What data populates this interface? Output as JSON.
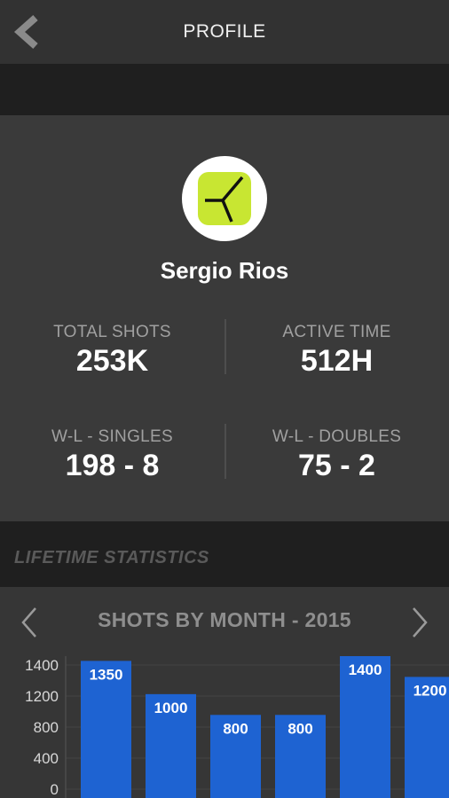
{
  "header": {
    "title": "PROFILE",
    "back_icon": "chevron-left-icon"
  },
  "profile": {
    "name": "Sergio Rios",
    "avatar_icon": "tennis-court-logo-icon",
    "accent_color": "#c8e632"
  },
  "stats": {
    "total_shots": {
      "label": "TOTAL SHOTS",
      "value": "253K"
    },
    "active_time": {
      "label": "ACTIVE TIME",
      "value": "512H"
    },
    "wl_singles": {
      "label": "W-L - SINGLES",
      "value": "198 - 8"
    },
    "wl_doubles": {
      "label": "W-L - DOUBLES",
      "value": "75 - 2"
    }
  },
  "section": {
    "heading": "LIFETIME STATISTICS"
  },
  "chart_data": {
    "type": "bar",
    "title": "SHOTS BY MONTH - 2015",
    "values": [
      1350,
      1000,
      800,
      800,
      1400,
      1200
    ],
    "value_labels": [
      "1350",
      "1000",
      "800",
      "800",
      "1400",
      "1200"
    ],
    "y_ticks": [
      "1400",
      "1200",
      "800",
      "400",
      "0"
    ],
    "y_tick_values": [
      1400,
      1200,
      800,
      400,
      0
    ],
    "bar_color": "#1e63d2",
    "grid": true,
    "legend": "none"
  }
}
